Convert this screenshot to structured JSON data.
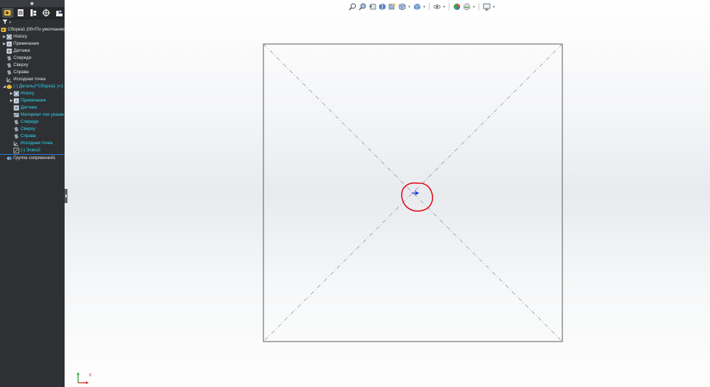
{
  "tree": {
    "tabs": [
      {
        "name": "feature-manager",
        "icon": "feature-tree-icon"
      },
      {
        "name": "property-manager",
        "icon": "property-list-icon"
      },
      {
        "name": "configuration-manager",
        "icon": "configuration-icon"
      },
      {
        "name": "dimxpert-manager",
        "icon": "target-icon"
      },
      {
        "name": "display-manager",
        "icon": "display-manager-icon"
      }
    ],
    "root_label": "Сборка1  (00<По умолчанию",
    "items": [
      {
        "label": "History"
      },
      {
        "label": "Примечания"
      },
      {
        "label": "Датчики"
      },
      {
        "label": "Спереди"
      },
      {
        "label": "Сверху"
      },
      {
        "label": "Справа"
      },
      {
        "label": "Исходная точка"
      },
      {
        "label": "(-) Деталь2^Сборка1 )<1"
      },
      {
        "label": "History"
      },
      {
        "label": "Примечания"
      },
      {
        "label": "Датчики"
      },
      {
        "label": "Материал <не указан"
      },
      {
        "label": "Спереди"
      },
      {
        "label": "Сверху"
      },
      {
        "label": "Справа"
      },
      {
        "label": "Исходная точка"
      },
      {
        "label": "(-) Эскиз2"
      },
      {
        "label": "Группа сопряжений1"
      }
    ]
  },
  "toolbar": {
    "buttons": [
      "zoom-to-fit-icon",
      "zoom-to-area-icon",
      "previous-view-icon",
      "section-view-icon",
      "dynamic-annotation-icon",
      "view-orientation-icon",
      "display-style-icon",
      "hide-show-icon",
      "appearance-icon",
      "scene-icon",
      "view-settings-icon"
    ]
  },
  "viewport": {
    "triad_axis_label": "X",
    "highlight_color": "#e0000f",
    "sketch_color": "#555555",
    "origin_color": "#1f39d9"
  }
}
